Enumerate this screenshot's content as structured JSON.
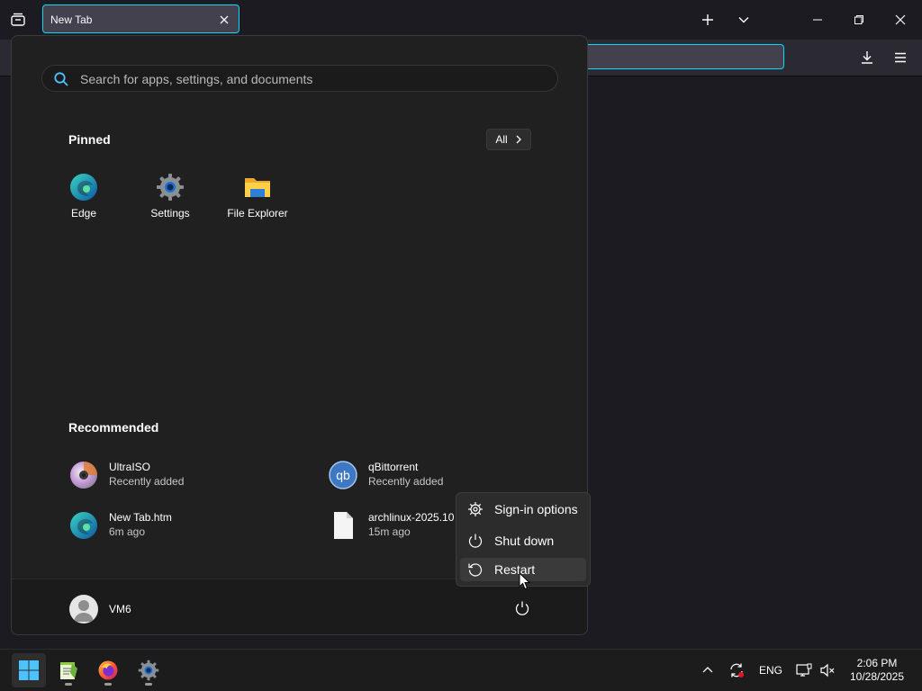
{
  "browser": {
    "tab_title": "New Tab"
  },
  "start_menu": {
    "search_placeholder": "Search for apps, settings, and documents",
    "pinned_title": "Pinned",
    "all_label": "All",
    "pinned": [
      {
        "label": "Edge",
        "icon": "edge-icon"
      },
      {
        "label": "Settings",
        "icon": "settings-gear-icon"
      },
      {
        "label": "File Explorer",
        "icon": "folder-icon"
      }
    ],
    "recommended_title": "Recommended",
    "recommended": [
      {
        "name": "UltraISO",
        "detail": "Recently added",
        "icon": "disc-icon"
      },
      {
        "name": "qBittorrent",
        "detail": "Recently added",
        "icon": "qbittorrent-icon"
      },
      {
        "name": "New Tab.htm",
        "detail": "6m ago",
        "icon": "edge-icon"
      },
      {
        "name": "archlinux-2025.10.",
        "detail": "15m ago",
        "icon": "file-icon"
      }
    ],
    "user_name": "VM6"
  },
  "power_menu": {
    "items": [
      {
        "label": "Sign-in options",
        "icon": "gear-icon"
      },
      {
        "label": "Shut down",
        "icon": "power-icon"
      },
      {
        "label": "Restart",
        "icon": "restart-icon"
      }
    ]
  },
  "taskbar": {
    "language": "ENG",
    "time": "2:06 PM",
    "date": "10/28/2025"
  },
  "colors": {
    "accent": "#00ddff",
    "start_bg": "#202020",
    "taskbar_bg": "#1c1c1c"
  }
}
